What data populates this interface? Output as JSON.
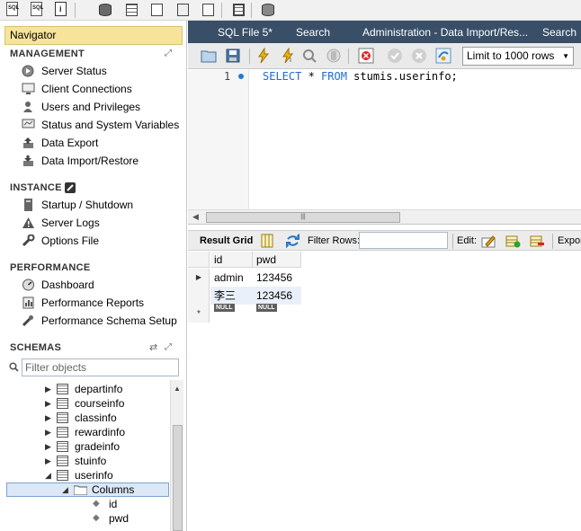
{
  "toolbar_icons": [
    "new-sql-tab-icon",
    "open-sql-file-icon",
    "inspector-icon",
    "create-schema-icon",
    "create-table-icon",
    "create-view-icon",
    "create-procedure-icon",
    "create-function-icon",
    "search-table-data-icon",
    "reconnect-icon"
  ],
  "navigator": {
    "title": "Navigator",
    "management": {
      "heading": "MANAGEMENT",
      "items": [
        "Server Status",
        "Client Connections",
        "Users and Privileges",
        "Status and System Variables",
        "Data Export",
        "Data Import/Restore"
      ]
    },
    "instance": {
      "heading": "INSTANCE",
      "items": [
        "Startup / Shutdown",
        "Server Logs",
        "Options File"
      ]
    },
    "performance": {
      "heading": "PERFORMANCE",
      "items": [
        "Dashboard",
        "Performance Reports",
        "Performance Schema Setup"
      ]
    },
    "schemas": {
      "heading": "SCHEMAS",
      "filter_placeholder": "Filter objects",
      "tables": [
        "departinfo",
        "courseinfo",
        "classinfo",
        "rewardinfo",
        "gradeinfo",
        "stuinfo",
        "userinfo"
      ],
      "columns_folder": "Columns",
      "columns": [
        "id",
        "pwd"
      ]
    }
  },
  "tabs": [
    "SQL File 5*",
    "Search",
    "Administration - Data Import/Res...",
    "Search"
  ],
  "sql_toolbar": {
    "limit_value": "Limit to 1000 rows"
  },
  "editor": {
    "line_number": "1",
    "query": {
      "kw1": "SELECT",
      "star": " * ",
      "kw2": "FROM",
      "table": " stumis.userinfo;"
    }
  },
  "result_toolbar": {
    "result_grid": "Result Grid",
    "filter_rows": "Filter Rows:",
    "edit": "Edit:",
    "export": "Expor"
  },
  "result_grid": {
    "columns": [
      "id",
      "pwd"
    ],
    "rows": [
      [
        "admin",
        "123456"
      ],
      [
        "李三",
        "123456"
      ]
    ],
    "new_row": [
      "NULL",
      "NULL"
    ],
    "row_markers": [
      "▶",
      "",
      "*"
    ]
  },
  "colors": {
    "tab_bar": "#384f67",
    "navigator_header": "#f7e39a",
    "sql_keyword": "#1f6bd6"
  }
}
